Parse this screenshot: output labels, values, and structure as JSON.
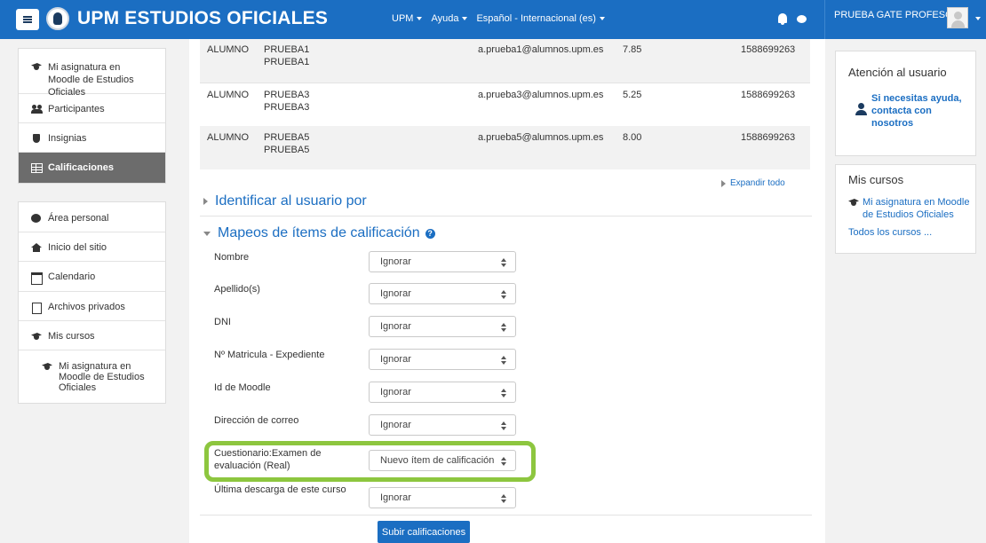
{
  "navbar": {
    "brand": "UPM ESTUDIOS OFICIALES",
    "menu": [
      {
        "label": "UPM"
      },
      {
        "label": "Ayuda"
      },
      {
        "label": "Español - Internacional (es)"
      }
    ],
    "user_name": "PRUEBA GATE PROFESOR"
  },
  "sidebar": {
    "course_block": [
      {
        "label": "Mi asignatura en Moodle de Estudios Oficiales",
        "icon": "graduation-cap-icon"
      },
      {
        "label": "Participantes",
        "icon": "users-icon"
      },
      {
        "label": "Insignias",
        "icon": "shield-icon"
      },
      {
        "label": "Calificaciones",
        "icon": "table-icon",
        "active": true
      }
    ],
    "nav_block": [
      {
        "label": "Área personal",
        "icon": "dashboard-icon"
      },
      {
        "label": "Inicio del sitio",
        "icon": "home-icon"
      },
      {
        "label": "Calendario",
        "icon": "calendar-icon"
      },
      {
        "label": "Archivos privados",
        "icon": "file-icon"
      },
      {
        "label": "Mis cursos",
        "icon": "graduation-cap-icon"
      },
      {
        "label": "Mi asignatura en Moodle de Estudios Oficiales",
        "icon": "graduation-cap-icon"
      }
    ]
  },
  "preview_rows": [
    {
      "first": "ALUMNO",
      "last": "PRUEBA1",
      "last2": "PRUEBA1",
      "email": "a.prueba1@alumnos.upm.es",
      "grade": "7.85",
      "id": "1588699263"
    },
    {
      "first": "ALUMNO",
      "last": "PRUEBA3",
      "last2": "PRUEBA3",
      "email": "a.prueba3@alumnos.upm.es",
      "grade": "5.25",
      "id": "1588699263"
    },
    {
      "first": "ALUMNO",
      "last": "PRUEBA5",
      "last2": "PRUEBA5",
      "email": "a.prueba5@alumnos.upm.es",
      "grade": "8.00",
      "id": "1588699263"
    }
  ],
  "main": {
    "expand_all": "Expandir todo",
    "section_identify": "Identificar al usuario por",
    "section_mappings": "Mapeos de ítems de calificación",
    "help_glyph": "?",
    "mappings": [
      {
        "label": "Nombre",
        "value": "Ignorar"
      },
      {
        "label": "Apellido(s)",
        "value": "Ignorar"
      },
      {
        "label": "DNI",
        "value": "Ignorar"
      },
      {
        "label": "Nº Matricula - Expediente",
        "value": "Ignorar"
      },
      {
        "label": "Id de Moodle",
        "value": "Ignorar"
      },
      {
        "label": "Dirección de correo",
        "value": "Ignorar"
      },
      {
        "label": "Cuestionario:Examen de evaluación (Real)",
        "value": "Nuevo ítem de calificación",
        "highlighted": true
      },
      {
        "label": "Última descarga de este curso",
        "value": "Ignorar"
      }
    ],
    "submit_label": "Subir calificaciones"
  },
  "right": {
    "support_title": "Atención al usuario",
    "support_link": "Si necesitas ayuda, contacta con nosotros",
    "courses_title": "Mis cursos",
    "course_link": "Mi asignatura en Moodle de Estudios Oficiales",
    "all_courses": "Todos los cursos ..."
  },
  "colors": {
    "brand_blue": "#1b6ec2",
    "highlight_green": "#8dc63f",
    "active_grey": "#6c6c6c"
  }
}
